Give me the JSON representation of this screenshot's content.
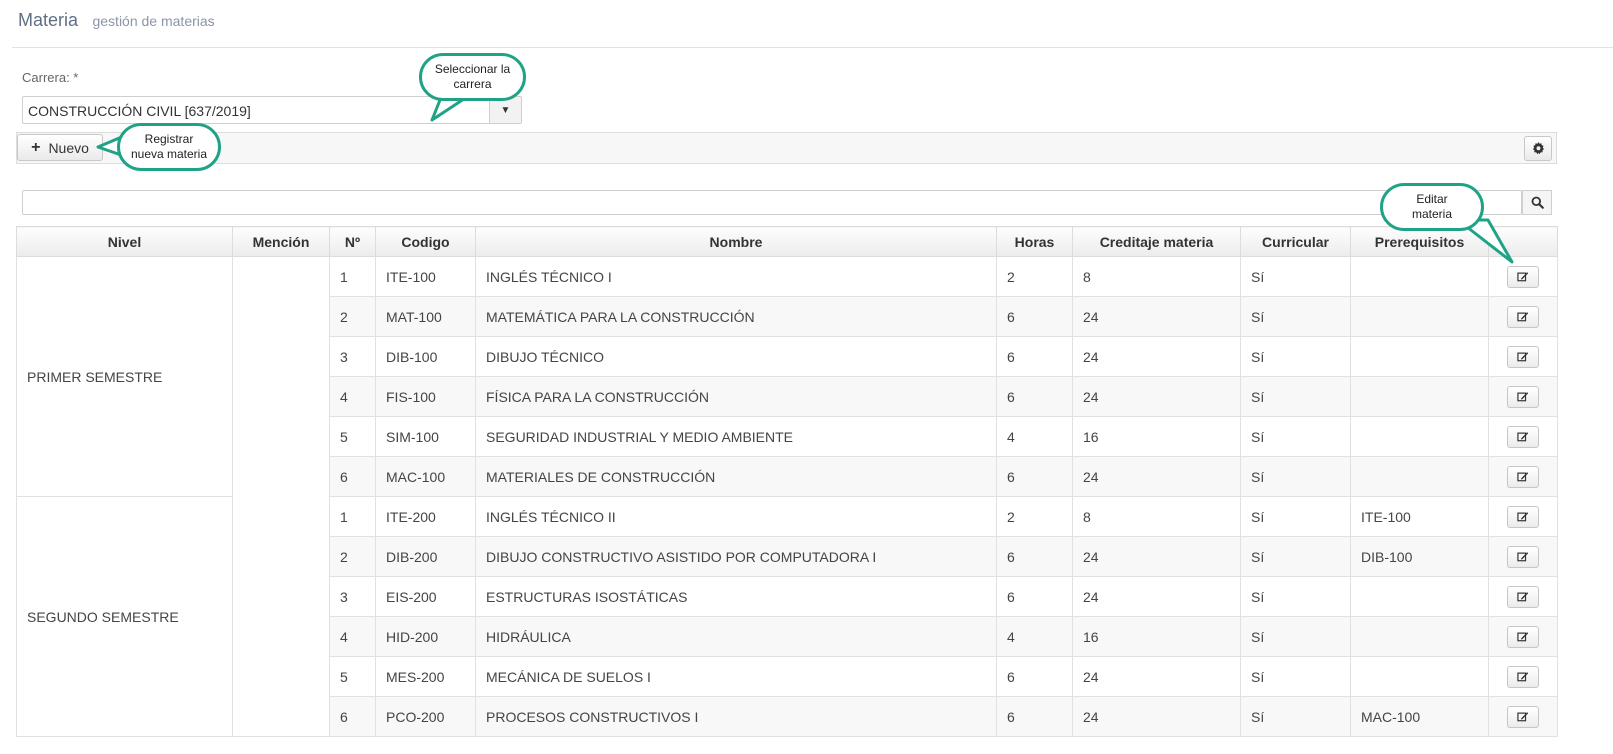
{
  "header": {
    "title": "Materia",
    "subtitle": "gestión de materias"
  },
  "form": {
    "carrera_label": "Carrera:  *",
    "carrera_value": "CONSTRUCCIÓN CIVIL [637/2019]"
  },
  "toolbar": {
    "new_label": "Nuevo"
  },
  "callouts": {
    "select": "Seleccionar la carrera",
    "nuevo": "Registrar nueva materia",
    "edit": "Editar materia"
  },
  "table": {
    "headers": [
      "Nivel",
      "Mención",
      "Nº",
      "Codigo",
      "Nombre",
      "Horas",
      "Creditaje materia",
      "Curricular",
      "Prerequisitos"
    ],
    "groups": [
      {
        "nivel": "PRIMER SEMESTRE",
        "rows": [
          [
            "1",
            "ITE-100",
            "INGLÉS TÉCNICO I",
            "2",
            "8",
            "Sí",
            ""
          ],
          [
            "2",
            "MAT-100",
            "MATEMÁTICA PARA LA CONSTRUCCIÓN",
            "6",
            "24",
            "Sí",
            ""
          ],
          [
            "3",
            "DIB-100",
            "DIBUJO TÉCNICO",
            "6",
            "24",
            "Sí",
            ""
          ],
          [
            "4",
            "FIS-100",
            "FÍSICA PARA LA CONSTRUCCIÓN",
            "6",
            "24",
            "Sí",
            ""
          ],
          [
            "5",
            "SIM-100",
            "SEGURIDAD INDUSTRIAL Y MEDIO AMBIENTE",
            "4",
            "16",
            "Sí",
            ""
          ],
          [
            "6",
            "MAC-100",
            "MATERIALES DE CONSTRUCCIÓN",
            "6",
            "24",
            "Sí",
            ""
          ]
        ]
      },
      {
        "nivel": "SEGUNDO SEMESTRE",
        "rows": [
          [
            "1",
            "ITE-200",
            "INGLÉS TÉCNICO II",
            "2",
            "8",
            "Sí",
            "ITE-100"
          ],
          [
            "2",
            "DIB-200",
            "DIBUJO CONSTRUCTIVO ASISTIDO POR COMPUTADORA I",
            "6",
            "24",
            "Sí",
            "DIB-100"
          ],
          [
            "3",
            "EIS-200",
            "ESTRUCTURAS ISOSTÁTICAS",
            "6",
            "24",
            "Sí",
            ""
          ],
          [
            "4",
            "HID-200",
            "HIDRÁULICA",
            "4",
            "16",
            "Sí",
            ""
          ],
          [
            "5",
            "MES-200",
            "MECÁNICA DE SUELOS I",
            "6",
            "24",
            "Sí",
            ""
          ],
          [
            "6",
            "PCO-200",
            "PROCESOS CONSTRUCTIVOS I",
            "6",
            "24",
            "Sí",
            "MAC-100"
          ]
        ]
      }
    ]
  },
  "icons": {
    "new": "plus-icon",
    "settings": "gear-icon",
    "search": "search-icon",
    "edit": "edit-icon",
    "dropdown": "caret-down-icon"
  },
  "colors": {
    "callout_border": "#1fa386"
  }
}
